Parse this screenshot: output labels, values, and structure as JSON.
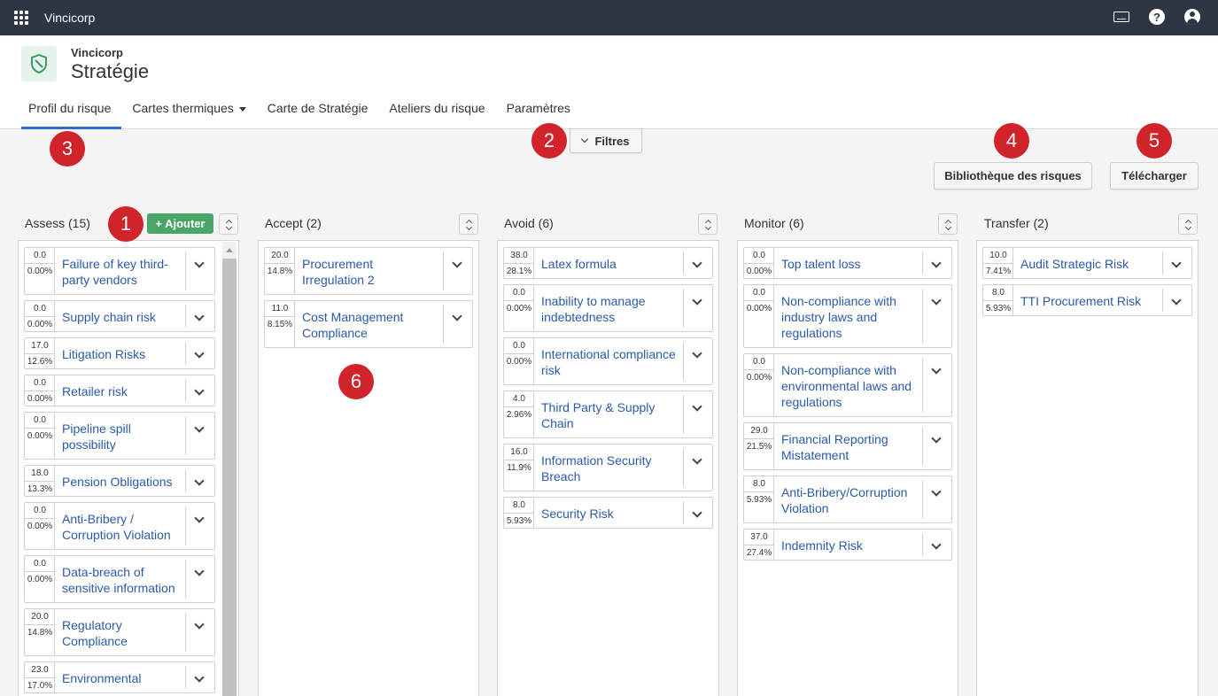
{
  "topbar": {
    "app_name": "Vincicorp"
  },
  "header": {
    "org": "Vincicorp",
    "title": "Stratégie"
  },
  "tabs": [
    "Profil du risque",
    "Cartes thermiques",
    "Carte de Stratégie",
    "Ateliers du risque",
    "Paramètres"
  ],
  "toolbar": {
    "filters": "Filtres",
    "library": "Bibliothèque des risques",
    "download": "Télécharger",
    "add": "+ Ajouter"
  },
  "markers": [
    "1",
    "2",
    "3",
    "4",
    "5",
    "6"
  ],
  "columns": [
    {
      "title": "Assess (15)",
      "cards": [
        {
          "v1": "0.0",
          "v2": "0.00%",
          "label": "Failure of key third-party vendors"
        },
        {
          "v1": "0.0",
          "v2": "0.00%",
          "label": "Supply chain risk"
        },
        {
          "v1": "17.0",
          "v2": "12.6%",
          "label": "Litigation Risks"
        },
        {
          "v1": "0.0",
          "v2": "0.00%",
          "label": "Retailer risk"
        },
        {
          "v1": "0.0",
          "v2": "0.00%",
          "label": "Pipeline spill possibility"
        },
        {
          "v1": "18.0",
          "v2": "13.3%",
          "label": "Pension Obligations"
        },
        {
          "v1": "0.0",
          "v2": "0.00%",
          "label": "Anti-Bribery / Corruption Violation"
        },
        {
          "v1": "0.0",
          "v2": "0.00%",
          "label": "Data-breach of sensitive information"
        },
        {
          "v1": "20.0",
          "v2": "14.8%",
          "label": "Regulatory Compliance"
        },
        {
          "v1": "23.0",
          "v2": "17.0%",
          "label": "Environmental"
        }
      ]
    },
    {
      "title": "Accept (2)",
      "cards": [
        {
          "v1": "20.0",
          "v2": "14.8%",
          "label": "Procurement Irregulation 2"
        },
        {
          "v1": "11.0",
          "v2": "8.15%",
          "label": "Cost Management Compliance"
        }
      ]
    },
    {
      "title": "Avoid (6)",
      "cards": [
        {
          "v1": "38.0",
          "v2": "28.1%",
          "label": "Latex formula"
        },
        {
          "v1": "0.0",
          "v2": "0.00%",
          "label": "Inability to manage indebtedness"
        },
        {
          "v1": "0.0",
          "v2": "0.00%",
          "label": "International compliance risk"
        },
        {
          "v1": "4.0",
          "v2": "2.96%",
          "label": "Third Party & Supply Chain"
        },
        {
          "v1": "16.0",
          "v2": "11.9%",
          "label": "Information Security Breach"
        },
        {
          "v1": "8.0",
          "v2": "5.93%",
          "label": "Security Risk"
        }
      ]
    },
    {
      "title": "Monitor (6)",
      "cards": [
        {
          "v1": "0.0",
          "v2": "0.00%",
          "label": "Top talent loss"
        },
        {
          "v1": "0.0",
          "v2": "0.00%",
          "label": "Non-compliance with industry laws and regulations"
        },
        {
          "v1": "0.0",
          "v2": "0.00%",
          "label": "Non-compliance with environmental laws and regulations"
        },
        {
          "v1": "29.0",
          "v2": "21.5%",
          "label": "Financial Reporting Mistatement"
        },
        {
          "v1": "8.0",
          "v2": "5.93%",
          "label": "Anti-Bribery/Corruption Violation"
        },
        {
          "v1": "37.0",
          "v2": "27.4%",
          "label": "Indemnity Risk"
        }
      ]
    },
    {
      "title": "Transfer (2)",
      "cards": [
        {
          "v1": "10.0",
          "v2": "7.41%",
          "label": "Audit Strategic Risk"
        },
        {
          "v1": "8.0",
          "v2": "5.93%",
          "label": "TTI Procurement Risk"
        }
      ]
    }
  ]
}
